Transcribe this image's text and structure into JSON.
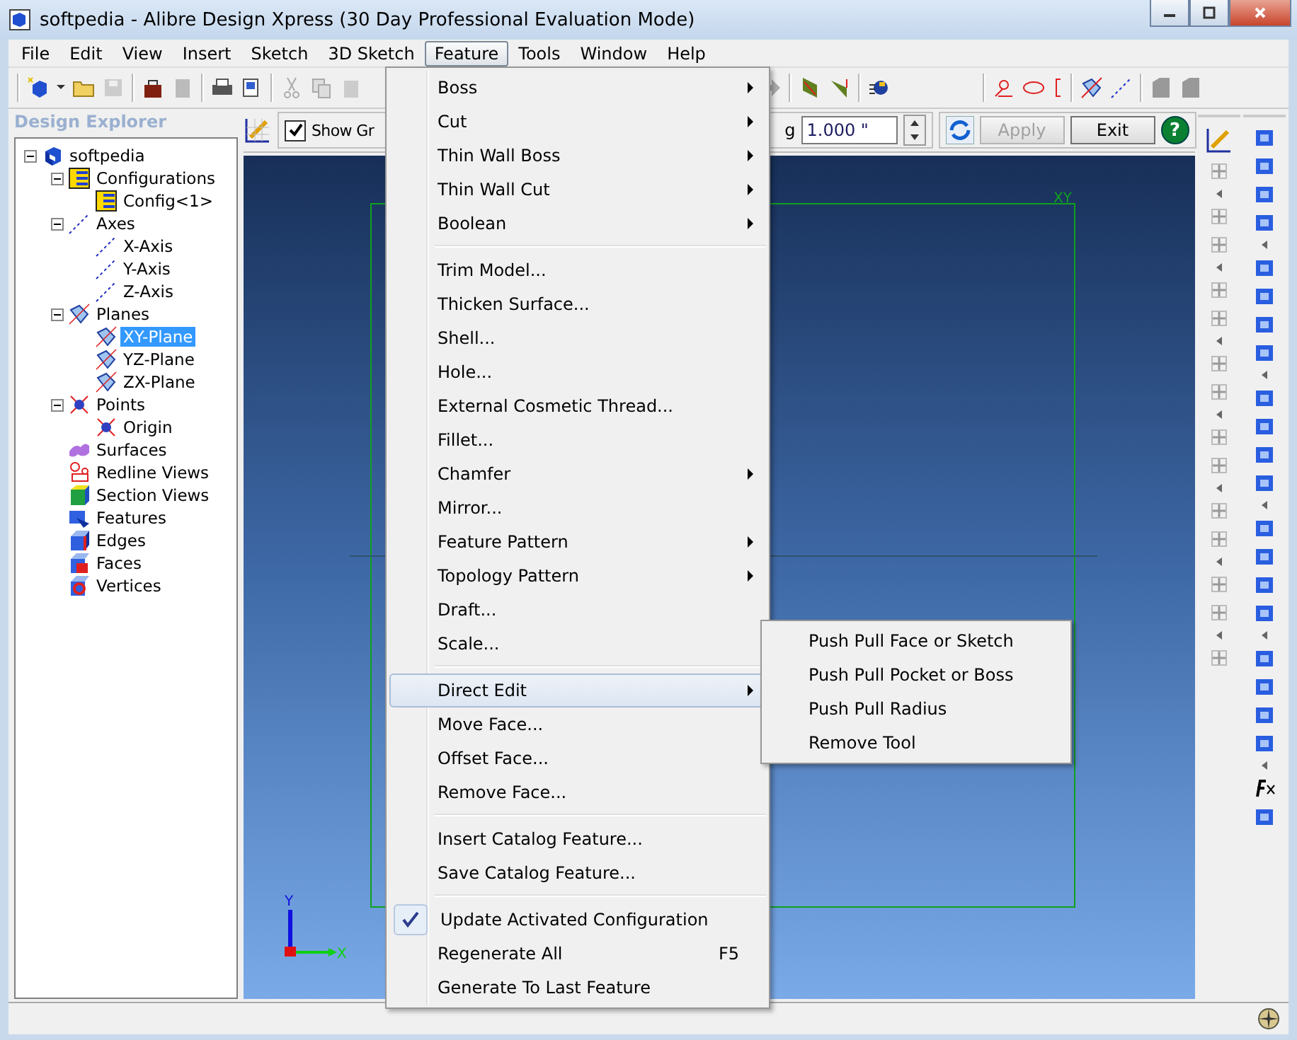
{
  "window": {
    "title": "softpedia - Alibre Design Xpress (30 Day Professional Evaluation Mode)"
  },
  "menubar": [
    {
      "label": "File",
      "selected": false
    },
    {
      "label": "Edit",
      "selected": false
    },
    {
      "label": "View",
      "selected": false
    },
    {
      "label": "Insert",
      "selected": false
    },
    {
      "label": "Sketch",
      "selected": false
    },
    {
      "label": "3D Sketch",
      "selected": false
    },
    {
      "label": "Feature",
      "selected": true
    },
    {
      "label": "Tools",
      "selected": false
    },
    {
      "label": "Window",
      "selected": false
    },
    {
      "label": "Help",
      "selected": false
    }
  ],
  "sketch_toolbar": {
    "show_grid": {
      "label": "Show Gr",
      "checked": true
    },
    "spacing_label": "g",
    "spacing_field": {
      "value": "1.000 \""
    },
    "buttons": [
      {
        "label": "Apply",
        "disabled": true
      },
      {
        "label": "Exit",
        "disabled": false
      }
    ],
    "help": "?"
  },
  "explorer": {
    "title": "Design Explorer",
    "tree": [
      {
        "label": "softpedia",
        "kind": "part",
        "selected": false,
        "expanded": true,
        "children": [
          {
            "label": "Configurations",
            "kind": "config",
            "selected": false,
            "expanded": true,
            "children": [
              {
                "label": "Config<1>",
                "kind": "config",
                "selected": false
              }
            ]
          },
          {
            "label": "Axes",
            "kind": "axis",
            "selected": false,
            "expanded": true,
            "children": [
              {
                "label": "X-Axis",
                "kind": "axis",
                "selected": false
              },
              {
                "label": "Y-Axis",
                "kind": "axis",
                "selected": false
              },
              {
                "label": "Z-Axis",
                "kind": "axis",
                "selected": false
              }
            ]
          },
          {
            "label": "Planes",
            "kind": "plane",
            "selected": false,
            "expanded": true,
            "children": [
              {
                "label": "XY-Plane",
                "kind": "plane",
                "selected": true
              },
              {
                "label": "YZ-Plane",
                "kind": "plane",
                "selected": false
              },
              {
                "label": "ZX-Plane",
                "kind": "plane",
                "selected": false
              }
            ]
          },
          {
            "label": "Points",
            "kind": "point",
            "selected": false,
            "expanded": true,
            "children": [
              {
                "label": "Origin",
                "kind": "point",
                "selected": false
              }
            ]
          },
          {
            "label": "Surfaces",
            "kind": "surfaces",
            "selected": false
          },
          {
            "label": "Redline Views",
            "kind": "redline",
            "selected": false
          },
          {
            "label": "Section Views",
            "kind": "section",
            "selected": false
          },
          {
            "label": "Features",
            "kind": "features",
            "selected": false
          },
          {
            "label": "Edges",
            "kind": "edges",
            "selected": false
          },
          {
            "label": "Faces",
            "kind": "faces",
            "selected": false
          },
          {
            "label": "Vertices",
            "kind": "vertices",
            "selected": false
          }
        ]
      }
    ]
  },
  "viewport": {
    "plane_label": "XY",
    "x_label": "X",
    "y_label": "Y"
  },
  "feature_menu": [
    {
      "kind": "item",
      "label": "Boss",
      "submenu": true,
      "checked": false,
      "selected": false
    },
    {
      "kind": "item",
      "label": "Cut",
      "submenu": true,
      "checked": false,
      "selected": false
    },
    {
      "kind": "item",
      "label": "Thin Wall Boss",
      "submenu": true,
      "checked": false,
      "selected": false
    },
    {
      "kind": "item",
      "label": "Thin Wall Cut",
      "submenu": true,
      "checked": false,
      "selected": false
    },
    {
      "kind": "item",
      "label": "Boolean",
      "submenu": true,
      "checked": false,
      "selected": false
    },
    {
      "kind": "separator"
    },
    {
      "kind": "item",
      "label": "Trim Model...",
      "submenu": false,
      "checked": false,
      "selected": false
    },
    {
      "kind": "item",
      "label": "Thicken Surface...",
      "submenu": false,
      "checked": false,
      "selected": false
    },
    {
      "kind": "item",
      "label": "Shell...",
      "submenu": false,
      "checked": false,
      "selected": false
    },
    {
      "kind": "item",
      "label": "Hole...",
      "submenu": false,
      "checked": false,
      "selected": false
    },
    {
      "kind": "item",
      "label": "External Cosmetic Thread...",
      "submenu": false,
      "checked": false,
      "selected": false
    },
    {
      "kind": "item",
      "label": "Fillet...",
      "submenu": false,
      "checked": false,
      "selected": false
    },
    {
      "kind": "item",
      "label": "Chamfer",
      "submenu": true,
      "checked": false,
      "selected": false
    },
    {
      "kind": "item",
      "label": "Mirror...",
      "submenu": false,
      "checked": false,
      "selected": false
    },
    {
      "kind": "item",
      "label": "Feature Pattern",
      "submenu": true,
      "checked": false,
      "selected": false
    },
    {
      "kind": "item",
      "label": "Topology Pattern",
      "submenu": true,
      "checked": false,
      "selected": false
    },
    {
      "kind": "item",
      "label": "Draft...",
      "submenu": false,
      "checked": false,
      "selected": false
    },
    {
      "kind": "item",
      "label": "Scale...",
      "submenu": false,
      "checked": false,
      "selected": false
    },
    {
      "kind": "separator"
    },
    {
      "kind": "item",
      "label": "Direct Edit",
      "submenu": true,
      "checked": false,
      "selected": true
    },
    {
      "kind": "item",
      "label": "Move Face...",
      "submenu": false,
      "checked": false,
      "selected": false
    },
    {
      "kind": "item",
      "label": "Offset Face...",
      "submenu": false,
      "checked": false,
      "selected": false
    },
    {
      "kind": "item",
      "label": "Remove Face...",
      "submenu": false,
      "checked": false,
      "selected": false
    },
    {
      "kind": "separator"
    },
    {
      "kind": "item",
      "label": "Insert Catalog Feature...",
      "submenu": false,
      "checked": false,
      "selected": false
    },
    {
      "kind": "item",
      "label": "Save Catalog Feature...",
      "submenu": false,
      "checked": false,
      "selected": false
    },
    {
      "kind": "separator"
    },
    {
      "kind": "item",
      "label": "Update Activated Configuration",
      "submenu": false,
      "checked": true,
      "selected": false
    },
    {
      "kind": "item",
      "label": "Regenerate All",
      "submenu": false,
      "checked": false,
      "selected": false,
      "shortcut": "F5"
    },
    {
      "kind": "item",
      "label": "Generate To Last Feature",
      "submenu": false,
      "checked": false,
      "selected": false
    }
  ],
  "direct_edit_submenu": [
    {
      "label": "Push Pull Face or Sketch",
      "selected": false
    },
    {
      "label": "Push Pull Pocket or Boss",
      "selected": false
    },
    {
      "label": "Push Pull Radius",
      "selected": false
    },
    {
      "label": "Remove Tool",
      "selected": false
    }
  ]
}
